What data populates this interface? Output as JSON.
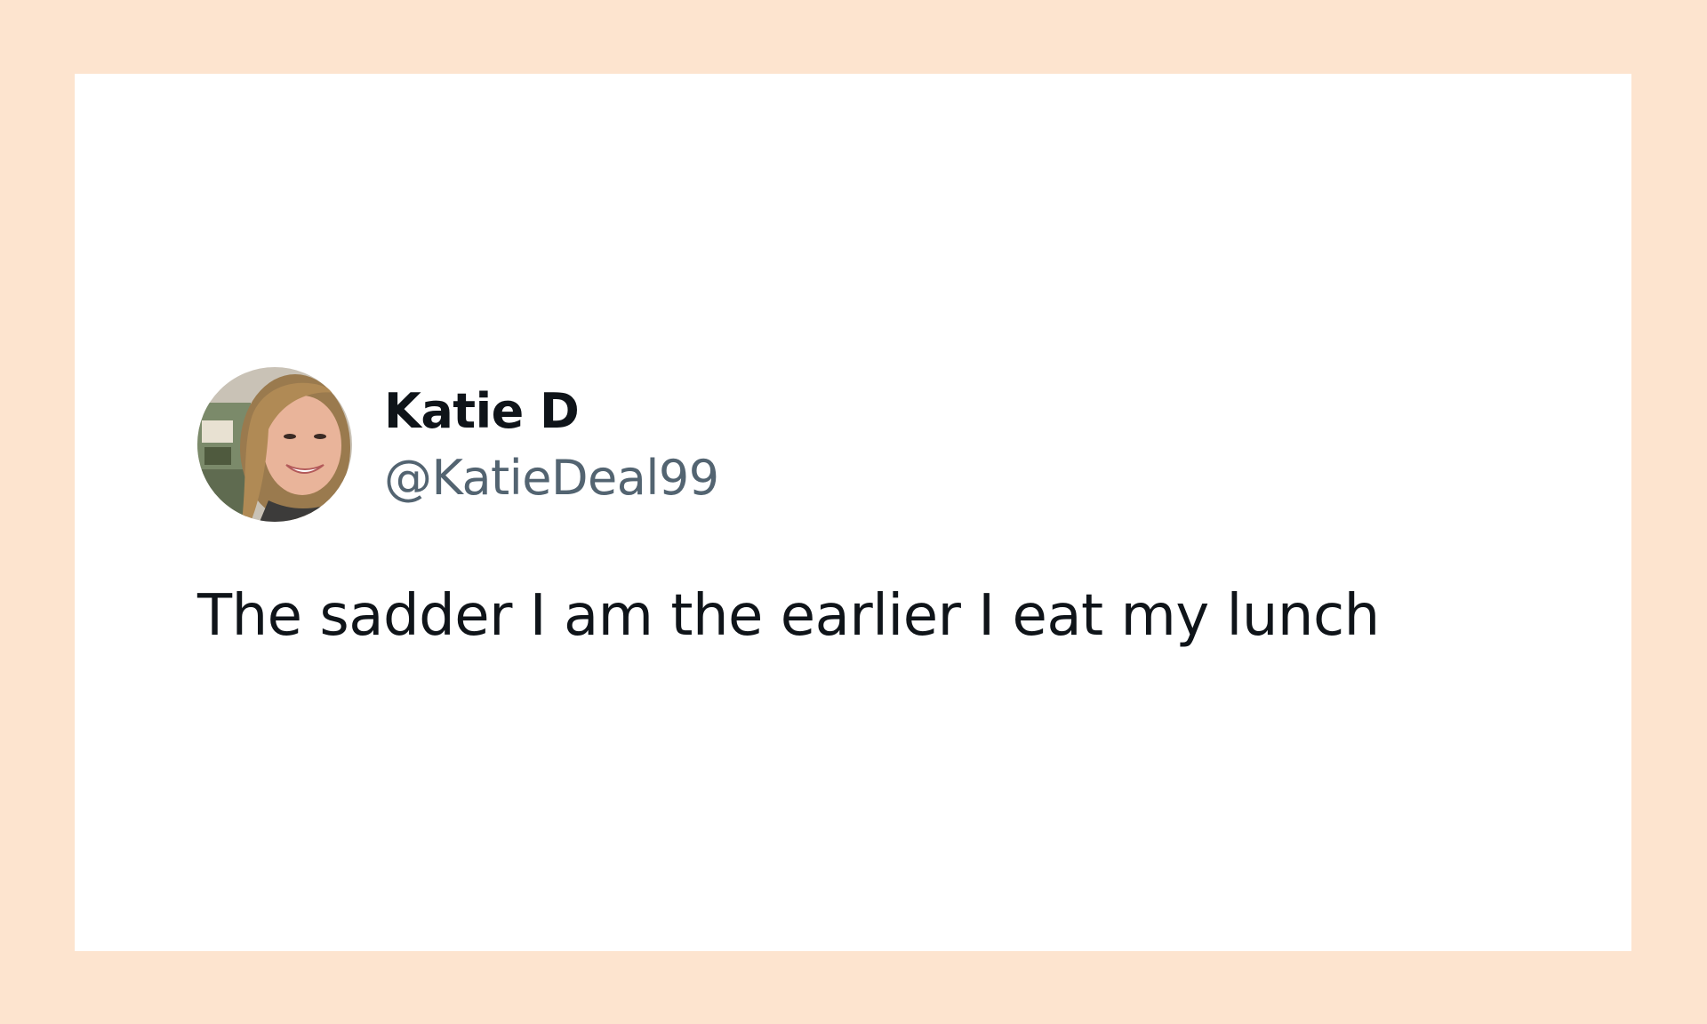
{
  "tweet": {
    "author": {
      "display_name": "Katie D",
      "handle": "@KatieDeal99",
      "avatar": "profile-photo"
    },
    "text": "The sadder I am the earlier I eat my lunch"
  },
  "colors": {
    "background": "#fde4cf",
    "card": "#ffffff",
    "name_text": "#0f1419",
    "handle_text": "#536471",
    "body_text": "#0f1419"
  }
}
